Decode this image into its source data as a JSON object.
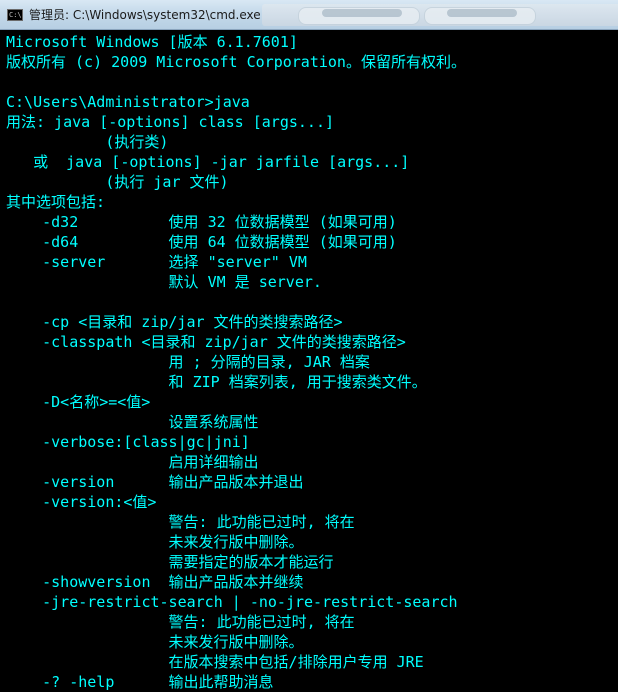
{
  "window": {
    "title": "管理员: C:\\Windows\\system32\\cmd.exe",
    "icon": "cmd-icon",
    "icon_text": "C:\\"
  },
  "colors": {
    "console_bg": "#000000",
    "console_text": "#00ffff"
  },
  "console": {
    "lines": [
      "Microsoft Windows [版本 6.1.7601]",
      "版权所有 (c) 2009 Microsoft Corporation。保留所有权利。",
      "",
      "C:\\Users\\Administrator>java",
      "用法: java [-options] class [args...]",
      "           (执行类)",
      "   或  java [-options] -jar jarfile [args...]",
      "           (执行 jar 文件)",
      "其中选项包括:",
      "    -d32          使用 32 位数据模型 (如果可用)",
      "    -d64          使用 64 位数据模型 (如果可用)",
      "    -server       选择 \"server\" VM",
      "                  默认 VM 是 server.",
      "",
      "    -cp <目录和 zip/jar 文件的类搜索路径>",
      "    -classpath <目录和 zip/jar 文件的类搜索路径>",
      "                  用 ; 分隔的目录, JAR 档案",
      "                  和 ZIP 档案列表, 用于搜索类文件。",
      "    -D<名称>=<值>",
      "                  设置系统属性",
      "    -verbose:[class|gc|jni]",
      "                  启用详细输出",
      "    -version      输出产品版本并退出",
      "    -version:<值>",
      "                  警告: 此功能已过时, 将在",
      "                  未来发行版中删除。",
      "                  需要指定的版本才能运行",
      "    -showversion  输出产品版本并继续",
      "    -jre-restrict-search | -no-jre-restrict-search",
      "                  警告: 此功能已过时, 将在",
      "                  未来发行版中删除。",
      "                  在版本搜索中包括/排除用户专用 JRE",
      "    -? -help      输出此帮助消息"
    ]
  }
}
